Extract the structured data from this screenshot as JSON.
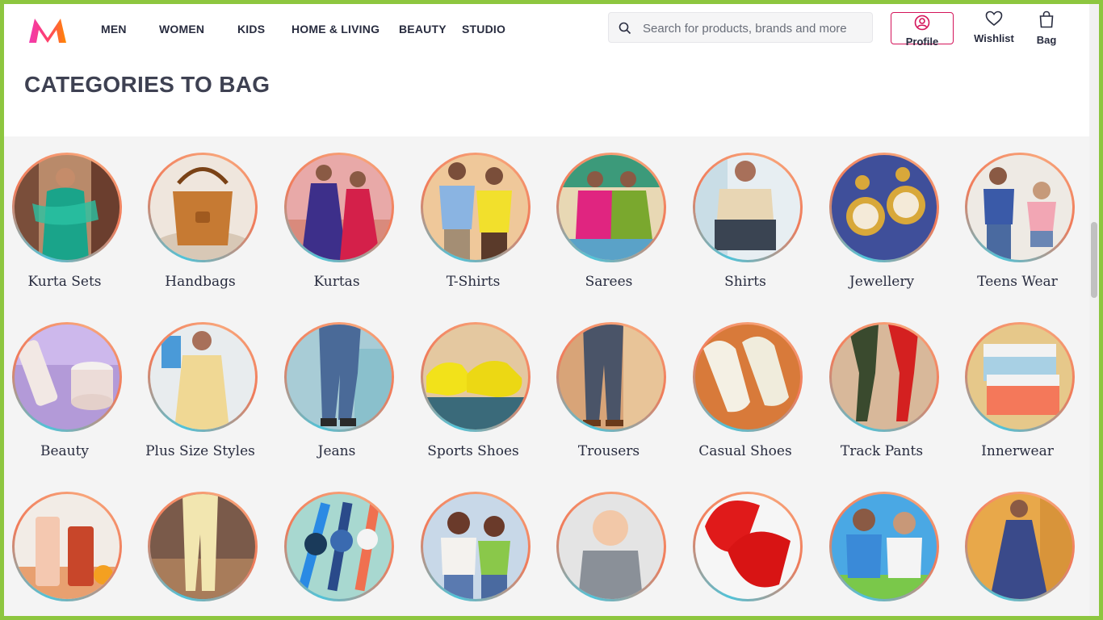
{
  "brand": {
    "logo_icon": "myntra-logo-icon",
    "accent": "#ff3f6c"
  },
  "nav": {
    "items": [
      {
        "label": "MEN"
      },
      {
        "label": "WOMEN"
      },
      {
        "label": "KIDS"
      },
      {
        "label": "HOME & LIVING"
      },
      {
        "label": "BEAUTY"
      },
      {
        "label": "STUDIO"
      }
    ]
  },
  "search": {
    "placeholder": "Search for products, brands and more",
    "value": ""
  },
  "actions": {
    "profile": "Profile",
    "wishlist": "Wishlist",
    "bag": "Bag"
  },
  "section": {
    "title": "CATEGORIES TO BAG"
  },
  "categories": [
    {
      "label": "Kurta Sets"
    },
    {
      "label": "Handbags"
    },
    {
      "label": "Kurtas"
    },
    {
      "label": "T-Shirts"
    },
    {
      "label": "Sarees"
    },
    {
      "label": "Shirts"
    },
    {
      "label": "Jewellery"
    },
    {
      "label": "Teens Wear"
    },
    {
      "label": "Beauty"
    },
    {
      "label": "Plus Size Styles"
    },
    {
      "label": "Jeans"
    },
    {
      "label": "Sports Shoes"
    },
    {
      "label": "Trousers"
    },
    {
      "label": "Casual Shoes"
    },
    {
      "label": "Track Pants"
    },
    {
      "label": "Innerwear"
    }
  ]
}
